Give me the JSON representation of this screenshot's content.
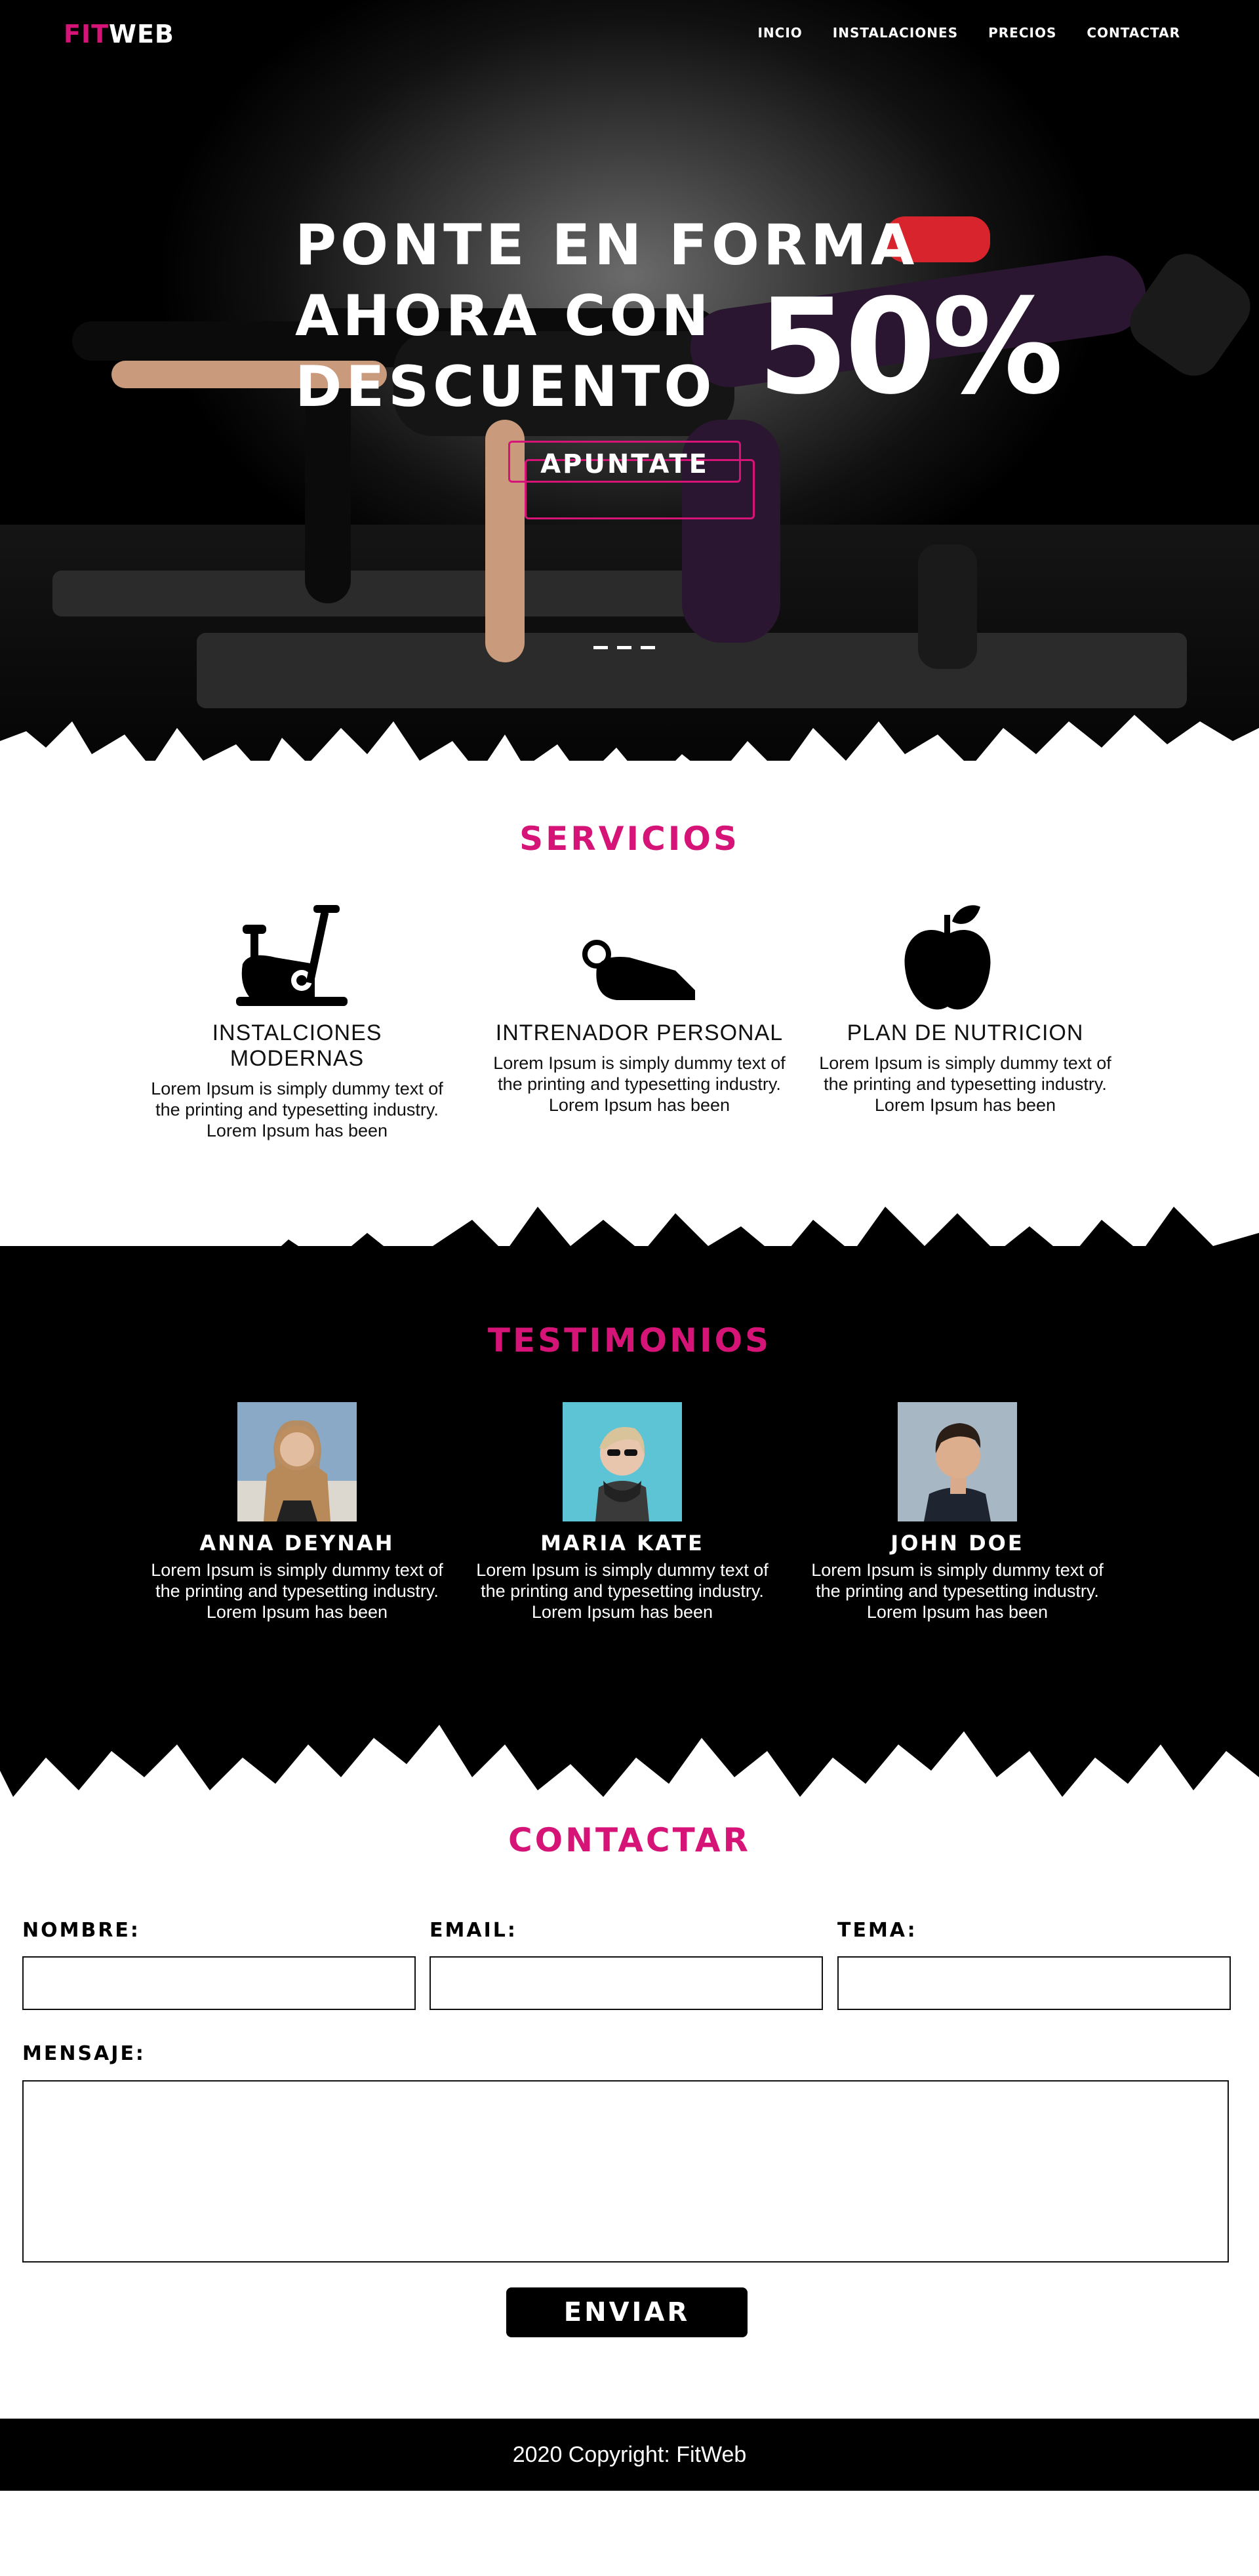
{
  "brand": {
    "fit": "FIT",
    "web": "WEB",
    "accent": "#d61478"
  },
  "nav": {
    "items": [
      "INCIO",
      "INSTALACIONES",
      "PRECIOS",
      "CONTACTAR"
    ]
  },
  "hero": {
    "line1": "PONTE EN FORMA",
    "line2": "AHORA CON",
    "line3": "DESCUENTO",
    "discount": "50%",
    "cta_label": "APUNTATE"
  },
  "servicios": {
    "title": "SERVICIOS",
    "items": [
      {
        "icon": "exercise-bike-icon",
        "title": "INSTALCIONES MODERNAS",
        "text": "Lorem Ipsum is simply dummy text of the printing and typesetting industry. Lorem Ipsum has been"
      },
      {
        "icon": "whistle-icon",
        "title": "INTRENADOR PERSONAL",
        "text": "Lorem Ipsum is simply dummy text of the printing and typesetting industry. Lorem Ipsum has been"
      },
      {
        "icon": "apple-icon",
        "title": "PLAN DE NUTRICION",
        "text": "Lorem Ipsum is simply dummy text of the printing and typesetting industry. Lorem Ipsum has been"
      }
    ]
  },
  "testimonios": {
    "title": "TESTIMONIOS",
    "items": [
      {
        "name": "ANNA DEYNAH",
        "text": "Lorem Ipsum is simply dummy text of the printing and typesetting industry. Lorem Ipsum has been"
      },
      {
        "name": "MARIA KATE",
        "text": "Lorem Ipsum is simply dummy text of the printing and typesetting industry. Lorem Ipsum has been"
      },
      {
        "name": "JOHN DOE",
        "text": "Lorem Ipsum is simply dummy text of the printing and typesetting industry. Lorem Ipsum has been"
      }
    ]
  },
  "contactar": {
    "title": "CONTACTAR",
    "nombre_label": "NOMBRE:",
    "email_label": "EMAIL:",
    "tema_label": "TEMA:",
    "mensaje_label": "MENSAJE:",
    "nombre_value": "",
    "email_value": "",
    "tema_value": "",
    "mensaje_value": "",
    "submit_label": "ENVIAR"
  },
  "footer": {
    "text": "2020 Copyright: FitWeb"
  }
}
